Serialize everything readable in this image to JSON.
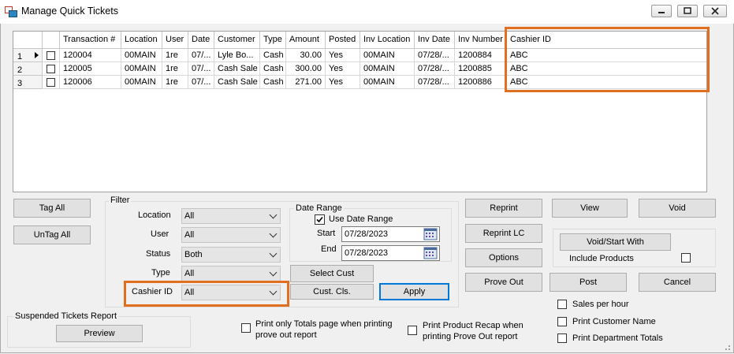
{
  "window": {
    "title": "Manage Quick Tickets",
    "minimize": "minimize",
    "maximize": "maximize",
    "close": "close"
  },
  "grid": {
    "columns": [
      "Transaction #",
      "Location",
      "User",
      "Date",
      "Customer",
      "Type",
      "Amount",
      "Posted",
      "Inv Location",
      "Inv Date",
      "Inv Number",
      "Cashier ID"
    ],
    "rows": [
      {
        "num": "1",
        "current": true,
        "cells": [
          "120004",
          "00MAIN",
          "1re",
          "07/...",
          "Lyle Bo...",
          "Cash",
          "30.00",
          "Yes",
          "00MAIN",
          "07/28/...",
          "1200884",
          "ABC"
        ]
      },
      {
        "num": "2",
        "current": false,
        "cells": [
          "120005",
          "00MAIN",
          "1re",
          "07/...",
          "Cash Sale",
          "Cash",
          "300.00",
          "Yes",
          "00MAIN",
          "07/28/...",
          "1200885",
          "ABC"
        ]
      },
      {
        "num": "3",
        "current": false,
        "cells": [
          "120006",
          "00MAIN",
          "1re",
          "07/...",
          "Cash Sale",
          "Cash",
          "271.00",
          "Yes",
          "00MAIN",
          "07/28/...",
          "1200886",
          "ABC"
        ]
      }
    ]
  },
  "buttons": {
    "tag_all": "Tag All",
    "untag_all": "UnTag All",
    "select_cust": "Select Cust",
    "cust_cls": "Cust. Cls.",
    "apply": "Apply",
    "reprint": "Reprint",
    "view": "View",
    "void": "Void",
    "reprint_lc": "Reprint LC",
    "options": "Options",
    "void_start_with": "Void/Start With",
    "prove_out": "Prove Out",
    "post": "Post",
    "cancel": "Cancel",
    "preview": "Preview"
  },
  "filter": {
    "legend": "Filter",
    "location_label": "Location",
    "location_value": "All",
    "user_label": "User",
    "user_value": "All",
    "status_label": "Status",
    "status_value": "Both",
    "type_label": "Type",
    "type_value": "All",
    "cashier_label": "Cashier ID",
    "cashier_value": "All"
  },
  "date_range": {
    "legend": "Date Range",
    "use_label": "Use Date Range",
    "use_checked": true,
    "start_label": "Start",
    "start_value": "07/28/2023",
    "end_label": "End",
    "end_value": "07/28/2023"
  },
  "options": {
    "include_products": "Include Products",
    "print_totals": "Print only Totals page when printing prove out report",
    "print_totals_line1": "Print only Totals page when printing",
    "print_totals_line2": "prove out report",
    "print_recap_line1": "Print Product Recap when",
    "print_recap_line2": "printing Prove Out report",
    "sales_per_hour": "Sales per hour",
    "print_customer_name": "Print Customer Name",
    "print_department_totals": "Print Department Totals"
  },
  "suspended": {
    "legend": "Suspended Tickets Report"
  },
  "colors": {
    "highlight": "#e07020",
    "primary_border": "#0078d7"
  }
}
